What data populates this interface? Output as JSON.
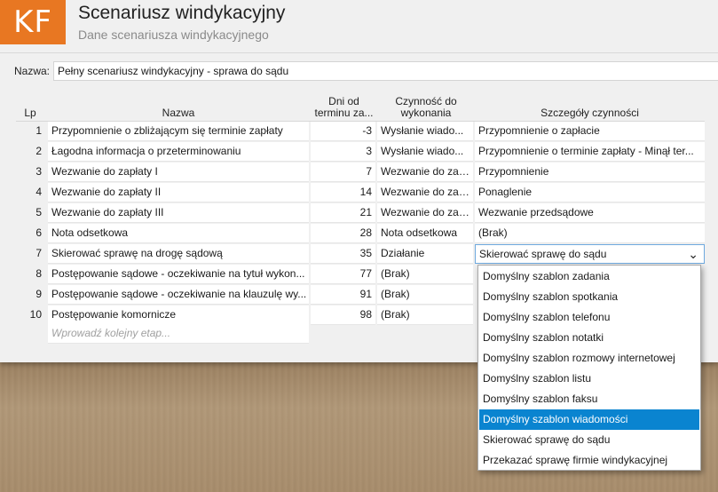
{
  "header": {
    "logo": "KF",
    "title": "Scenariusz windykacyjny",
    "subtitle": "Dane scenariusza windykacyjnego"
  },
  "name_field": {
    "label": "Nazwa:",
    "value": "Pełny scenariusz windykacyjny - sprawa do sądu"
  },
  "table": {
    "columns": {
      "lp": "Lp",
      "name": "Nazwa",
      "days": "Dni od terminu za...",
      "action": "Czynność do wykonania",
      "details": "Szczegóły czynności"
    },
    "rows": [
      {
        "lp": "1",
        "name": "Przypomnienie o zbliżającym się terminie zapłaty",
        "days": "-3",
        "action": "Wysłanie wiado...",
        "details": "Przypomnienie o zapłacie"
      },
      {
        "lp": "2",
        "name": "Łagodna informacja o przeterminowaniu",
        "days": "3",
        "action": "Wysłanie wiado...",
        "details": "Przypomnienie o terminie zapłaty - Minął ter..."
      },
      {
        "lp": "3",
        "name": "Wezwanie do zapłaty I",
        "days": "7",
        "action": "Wezwanie do zap...",
        "details": "Przypomnienie"
      },
      {
        "lp": "4",
        "name": "Wezwanie do zapłaty II",
        "days": "14",
        "action": "Wezwanie do zap...",
        "details": "Ponaglenie"
      },
      {
        "lp": "5",
        "name": "Wezwanie do zapłaty III",
        "days": "21",
        "action": "Wezwanie do zap...",
        "details": "Wezwanie przedsądowe"
      },
      {
        "lp": "6",
        "name": "Nota odsetkowa",
        "days": "28",
        "action": "Nota odsetkowa",
        "details": "(Brak)"
      },
      {
        "lp": "7",
        "name": "Skierować sprawę na drogę sądową",
        "days": "35",
        "action": "Działanie",
        "details": "Skierować sprawę do sądu"
      },
      {
        "lp": "8",
        "name": "Postępowanie sądowe - oczekiwanie na tytuł wykon...",
        "days": "77",
        "action": "(Brak)",
        "details": ""
      },
      {
        "lp": "9",
        "name": "Postępowanie sądowe - oczekiwanie na klauzulę wy...",
        "days": "91",
        "action": "(Brak)",
        "details": ""
      },
      {
        "lp": "10",
        "name": "Postępowanie komornicze",
        "days": "98",
        "action": "(Brak)",
        "details": ""
      }
    ],
    "new_step_placeholder": "Wprowadź kolejny etap..."
  },
  "dropdown": {
    "selected_index": 7,
    "options": [
      "Domyślny szablon zadania",
      "Domyślny szablon spotkania",
      "Domyślny szablon telefonu",
      "Domyślny szablon notatki",
      "Domyślny szablon rozmowy internetowej",
      "Domyślny szablon listu",
      "Domyślny szablon faksu",
      "Domyślny szablon wiadomości",
      "Skierować sprawę do sądu",
      "Przekazać sprawę firmie windykacyjnej"
    ]
  },
  "colors": {
    "accent": "#e87722",
    "highlight": "#0a84d0"
  }
}
